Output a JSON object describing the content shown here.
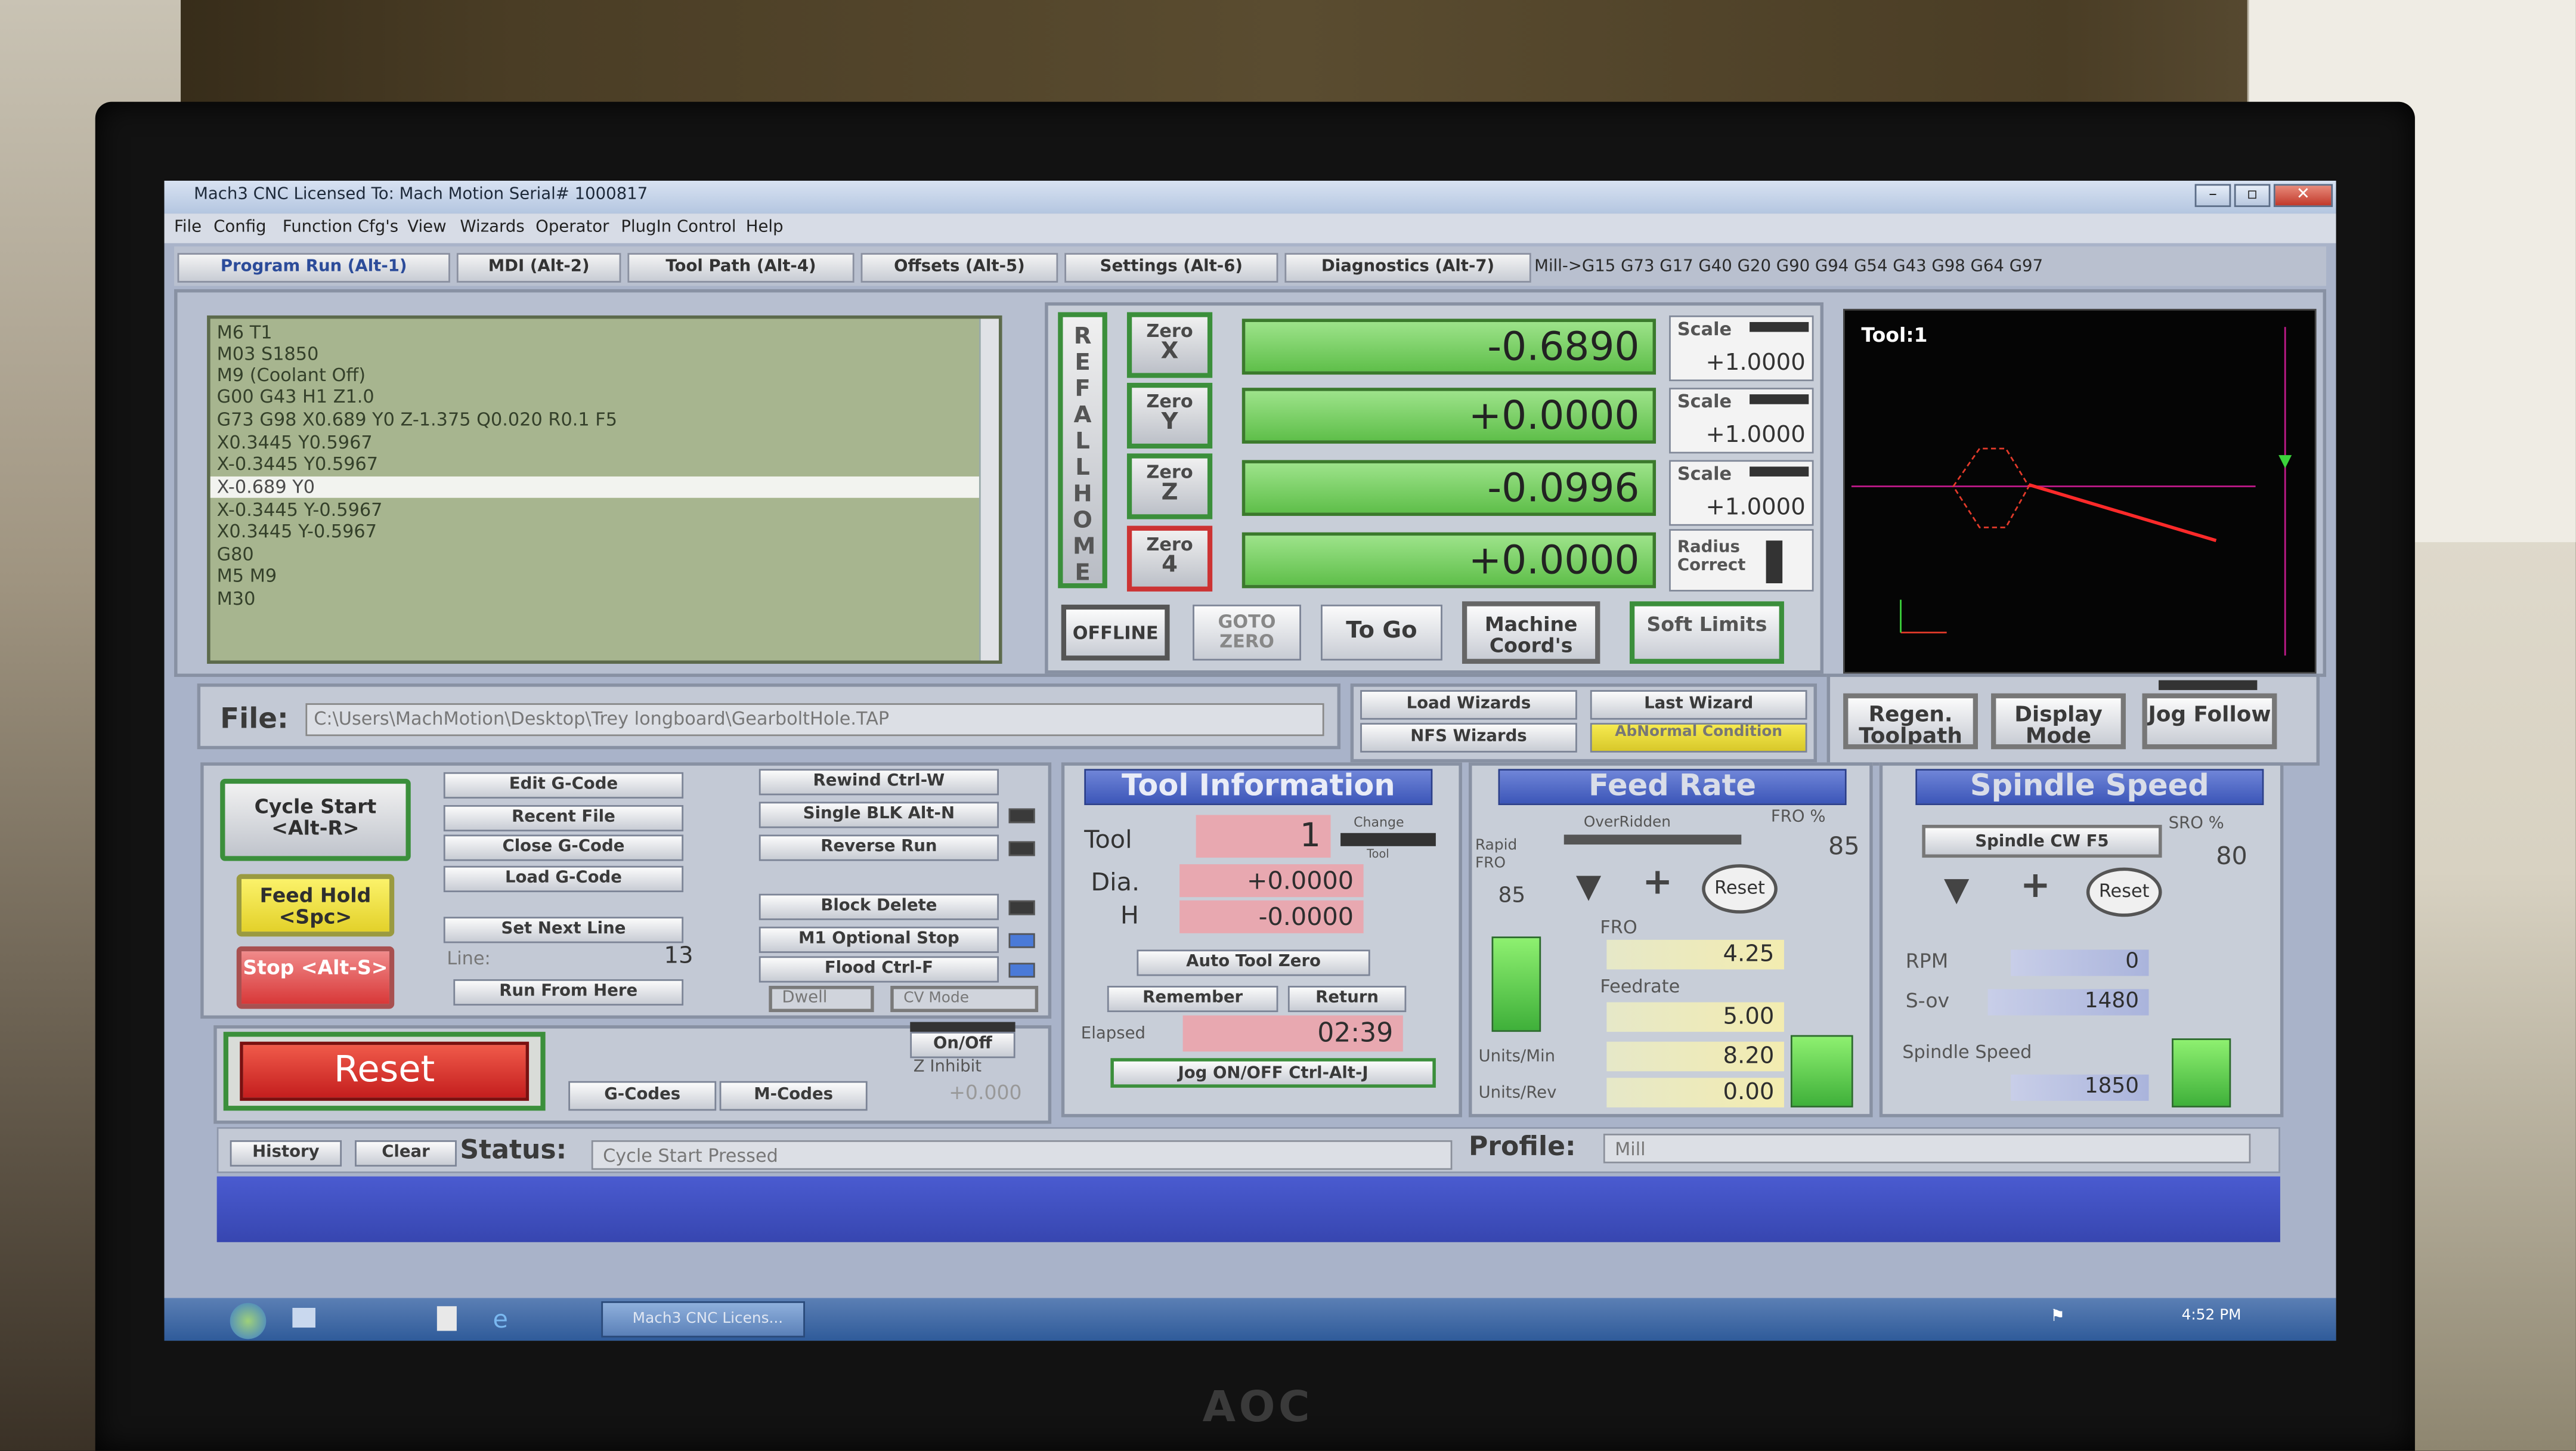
{
  "window": {
    "title": "Mach3 CNC  Licensed To: Mach Motion Serial# 1000817",
    "menu": [
      "File",
      "Config",
      "Function Cfg's",
      "View",
      "Wizards",
      "Operator",
      "PlugIn Control",
      "Help"
    ]
  },
  "tabs": [
    "Program Run (Alt-1)",
    "MDI (Alt-2)",
    "Tool Path (Alt-4)",
    "Offsets (Alt-5)",
    "Settings (Alt-6)",
    "Diagnostics (Alt-7)"
  ],
  "modal_codes": "Mill->G15  G73 G17 G40 G20 G90 G94 G54 G43 G98 G64 G97",
  "gcode_lines": [
    "M6 T1",
    "M03 S1850",
    "M9 (Coolant Off)",
    "G00 G43 H1 Z1.0",
    "G73 G98 X0.689 Y0 Z-1.375 Q0.020 R0.1 F5",
    "X0.3445 Y0.5967",
    "X-0.3445 Y0.5967",
    "X-0.689 Y0",
    "X-0.3445 Y-0.5967",
    "X0.3445 Y-0.5967",
    "G80",
    "M5 M9",
    "M30"
  ],
  "dro": {
    "ref_all_home": "REFALLHOME",
    "axes": [
      {
        "zero_label": "Zero",
        "axis": "X",
        "value": "-0.6890",
        "scale_label": "Scale",
        "scale": "+1.0000"
      },
      {
        "zero_label": "Zero",
        "axis": "Y",
        "value": "+0.0000",
        "scale_label": "Scale",
        "scale": "+1.0000"
      },
      {
        "zero_label": "Zero",
        "axis": "Z",
        "value": "-0.0996",
        "scale_label": "Scale",
        "scale": "+1.0000"
      },
      {
        "zero_label": "Zero",
        "axis": "4",
        "value": "+0.0000",
        "scale_label": "Radius Correct",
        "scale": ""
      }
    ],
    "buttons": [
      "OFFLINE",
      "GOTO ZERO",
      "To Go",
      "Machine Coord's",
      "Soft Limits"
    ]
  },
  "toolpath": {
    "tool_label": "Tool:1"
  },
  "file": {
    "label": "File:",
    "path": "C:\\Users\\MachMotion\\Desktop\\Trey longboard\\GearboltHole.TAP"
  },
  "wizards": {
    "load": "Load Wizards",
    "last": "Last Wizard",
    "nfs": "NFS Wizards",
    "abnormal": "AbNormal Condition"
  },
  "toolpath_buttons": [
    "Regen. Toolpath",
    "Display Mode",
    "Jog Follow"
  ],
  "program_controls": {
    "cycle_start": "Cycle Start <Alt-R>",
    "feed_hold": "Feed Hold <Spc>",
    "stop": "Stop <Alt-S>",
    "edit": "Edit G-Code",
    "recent": "Recent File",
    "close": "Close G-Code",
    "load": "Load G-Code",
    "set_next": "Set Next Line",
    "line_label": "Line:",
    "line_value": "13",
    "run_from_here": "Run From Here",
    "rewind": "Rewind Ctrl-W",
    "single_blk": "Single BLK Alt-N",
    "reverse_run": "Reverse Run",
    "block_delete": "Block Delete",
    "m1_stop": "M1 Optional Stop",
    "flood": "Flood Ctrl-F",
    "dwell": "Dwell",
    "cv_mode": "CV Mode",
    "reset": "Reset",
    "gcodes": "G-Codes",
    "mcodes": "M-Codes",
    "onoff": "On/Off",
    "z_inhibit": "Z Inhibit",
    "z_inhibit_value": "+0.000"
  },
  "tool_info": {
    "title": "Tool Information",
    "tool_label": "Tool",
    "tool_value": "1",
    "change_label": "Change",
    "change_sub": "Tool",
    "dia_label": "Dia.",
    "dia_value": "+0.0000",
    "h_label": "H",
    "h_value": "-0.0000",
    "auto_zero": "Auto Tool Zero",
    "remember": "Remember",
    "return": "Return",
    "elapsed_label": "Elapsed",
    "elapsed_value": "02:39",
    "jog": "Jog ON/OFF Ctrl-Alt-J"
  },
  "feed_rate": {
    "title": "Feed Rate",
    "overridden": "OverRidden",
    "fro_pct_label": "FRO %",
    "fro_pct_value": "85",
    "rapid_label": "Rapid FRO",
    "rapid_value": "85",
    "reset": "Reset",
    "fro_label": "FRO",
    "fro_value": "4.25",
    "feedrate_label": "Feedrate",
    "feedrate_value": "5.00",
    "units_min_label": "Units/Min",
    "units_min_value": "8.20",
    "units_rev_label": "Units/Rev",
    "units_rev_value": "0.00"
  },
  "spindle": {
    "title": "Spindle Speed",
    "cw_button": "Spindle CW F5",
    "sro_label": "SRO %",
    "sro_value": "80",
    "reset": "Reset",
    "rpm_label": "RPM",
    "rpm_value": "0",
    "sov_label": "S-ov",
    "sov_value": "1480",
    "speed_label": "Spindle Speed",
    "speed_value": "1850"
  },
  "status": {
    "history": "History",
    "clear": "Clear",
    "label": "Status:",
    "text": "Cycle Start Pressed",
    "profile_label": "Profile:",
    "profile_value": "Mill"
  },
  "taskbar": {
    "clock": "4:52 PM",
    "task": "Mach3 CNC  Licens..."
  },
  "monitor": {
    "brand": "AOC"
  },
  "colors": {
    "dro_green": "#6fcf58",
    "header_blue": "#4a63c4",
    "reset_red": "#d93a3a",
    "feed_hold_yellow": "#f0e040"
  }
}
